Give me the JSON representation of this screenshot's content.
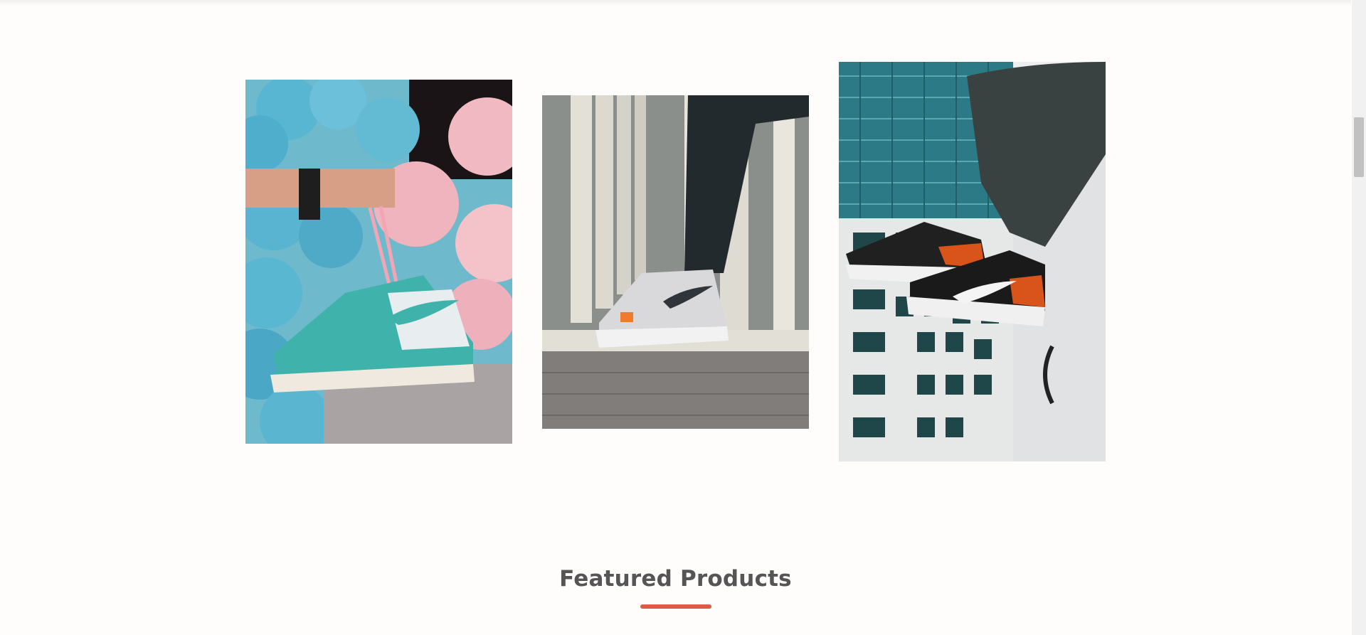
{
  "gallery": {
    "images": [
      {
        "icon": "sneaker-photo-teal-high-top-balloons"
      },
      {
        "icon": "sneaker-photo-white-low-top-columns"
      },
      {
        "icon": "sneaker-photo-black-orange-low-top-building"
      }
    ]
  },
  "featured": {
    "title": "Featured Products",
    "accent_color": "#e05a42"
  },
  "colors": {
    "background": "#fffdfc",
    "title_text": "#555555"
  }
}
